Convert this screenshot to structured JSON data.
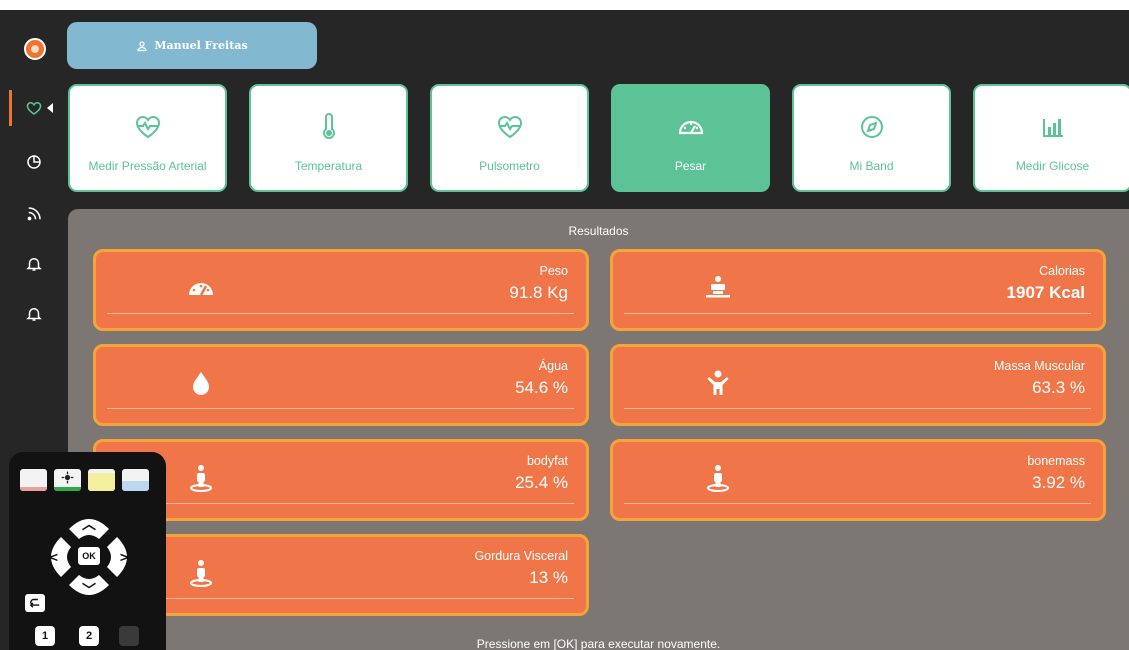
{
  "user": {
    "name": "Manuel Freitas"
  },
  "measures": [
    {
      "label": "Medir Pressão Arterial",
      "icon": "heart-pulse-icon"
    },
    {
      "label": "Temperatura",
      "icon": "thermometer-icon"
    },
    {
      "label": "Pulsometro",
      "icon": "heart-pulse-icon"
    },
    {
      "label": "Pesar",
      "icon": "gauge-icon",
      "active": true
    },
    {
      "label": "Mi Band",
      "icon": "compass-icon"
    },
    {
      "label": "Medir Glicose",
      "icon": "bar-chart-icon"
    }
  ],
  "results": {
    "title": "Resultados",
    "items": [
      {
        "label": "Peso",
        "value": "91.8 Kg",
        "icon": "gauge-icon"
      },
      {
        "label": "Calorias",
        "value": "1907 Kcal",
        "icon": "scale-person-icon"
      },
      {
        "label": "Água",
        "value": "54.6 %",
        "icon": "water-drop-icon"
      },
      {
        "label": "Massa Muscular",
        "value": "63.3 %",
        "icon": "child-icon"
      },
      {
        "label": "bodyfat",
        "value": "25.4 %",
        "icon": "person-pin-icon"
      },
      {
        "label": "bonemass",
        "value": "3.92 %",
        "icon": "person-pin-icon"
      },
      {
        "label": "Gordura Visceral",
        "value": "13 %",
        "icon": "person-pin-icon"
      }
    ]
  },
  "footer": {
    "hint": "Pressione em [OK] para executar novamente."
  },
  "remote": {
    "ok_label": "OK",
    "keys": [
      "1",
      "2"
    ],
    "color_buttons": [
      "#e8a0a0",
      "#2faa4a",
      "#f3ef9c",
      "#bcd8f0"
    ]
  },
  "colors": {
    "accent_green": "#5cc397",
    "tile_orange": "#f0764a",
    "tile_border": "#f6a43a",
    "user_tab_blue": "#82b9d1"
  }
}
